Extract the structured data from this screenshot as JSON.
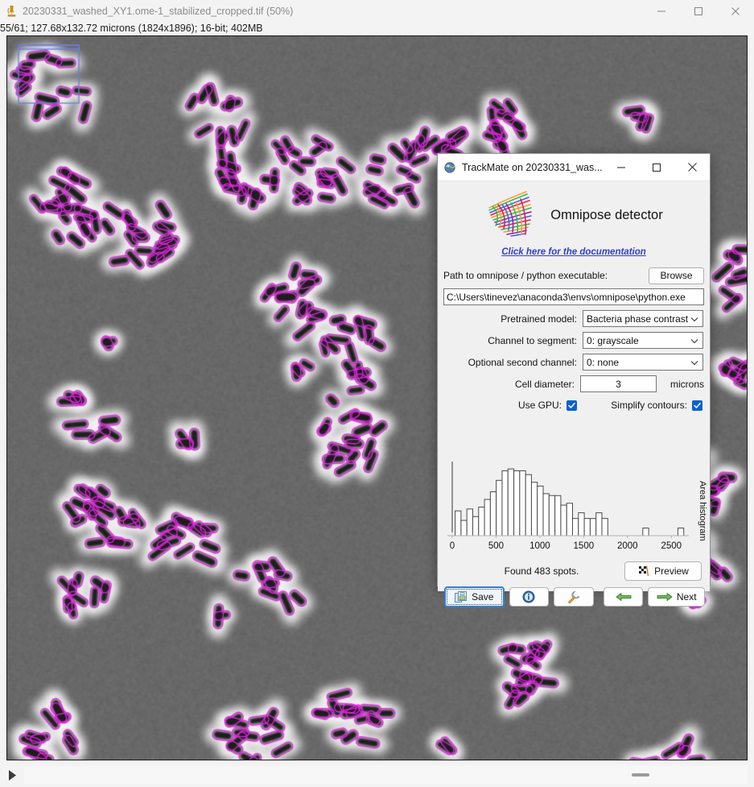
{
  "main_window": {
    "icon": "microscope-icon",
    "title": "20230331_washed_XY1.ome-1_stabilized_cropped.tif (50%)",
    "minimize_label": "minimize-icon",
    "maximize_label": "maximize-icon",
    "close_label": "close-icon",
    "info_line": "55/61; 127.68x132.72 microns (1824x1896); 16-bit; 402MB",
    "play_icon": "play-icon"
  },
  "dialog": {
    "icon": "trackmate-icon",
    "title": "TrackMate on 20230331_was...",
    "minimize_label": "minimize-icon",
    "maximize_label": "maximize-icon",
    "close_label": "close-icon",
    "logo_title": "Omnipose detector",
    "doc_link": "Click here for the documentation",
    "path_label": "Path to omnipose / python executable:",
    "browse_label": "Browse",
    "path_value": "C:\\Users\\tinevez\\anaconda3\\envs\\omnipose\\python.exe",
    "fields": [
      {
        "label": "Pretrained model:",
        "value": "Bacteria phase contrast"
      },
      {
        "label": "Channel to segment:",
        "value": "0: grayscale"
      },
      {
        "label": "Optional second channel:",
        "value": "0: none"
      }
    ],
    "diameter_label": "Cell diameter:",
    "diameter_value": "3",
    "diameter_unit": "microns",
    "use_gpu_label": "Use GPU:",
    "use_gpu_checked": "✓",
    "simplify_label": "Simplify contours:",
    "simplify_checked": "✓",
    "status_text": "Found 483 spots.",
    "preview_label": "Preview",
    "preview_icon": "checkered-flag-icon",
    "save_label": "Save",
    "save_icon": "save-disk-icon",
    "info_icon": "info-circle-icon",
    "wrench_icon": "wrench-icon",
    "prev_icon": "arrow-left-icon",
    "next_label": "Next",
    "next_icon": "arrow-right-icon"
  },
  "colors": {
    "accent_blue": "#0c63c8",
    "link_blue": "#3240c9",
    "focus_blue": "#2f7fd4",
    "green_arrow": "#3f9a3f",
    "cell_outline": "#e81fe8",
    "background_gray": "#6d6d6d",
    "dialog_bg": "#f0f0f0"
  },
  "chart_data": {
    "type": "bar",
    "title": "",
    "xlabel": "",
    "ylabel": "Area histogram",
    "legend": "none",
    "grid": false,
    "xlim": [
      0,
      2700
    ],
    "ylim": [
      0,
      38
    ],
    "bin_width": 67,
    "xticks": [
      0,
      500,
      1000,
      1500,
      2000,
      2500
    ],
    "xtick_labels": [
      "0",
      "500",
      "1000",
      "1500",
      "2000",
      "2500"
    ],
    "bin_starts": [
      33,
      100,
      167,
      234,
      301,
      368,
      435,
      502,
      569,
      636,
      703,
      770,
      837,
      904,
      971,
      1038,
      1105,
      1172,
      1239,
      1306,
      1373,
      1440,
      1507,
      1574,
      1641,
      1708,
      1775,
      2175,
      2575
    ],
    "values": [
      13,
      8,
      14,
      10,
      15,
      19,
      23,
      29,
      34,
      35,
      34,
      34,
      32,
      28,
      26,
      22,
      21,
      21,
      16,
      17,
      9,
      12,
      9,
      9,
      12,
      9,
      0,
      4,
      4
    ]
  }
}
